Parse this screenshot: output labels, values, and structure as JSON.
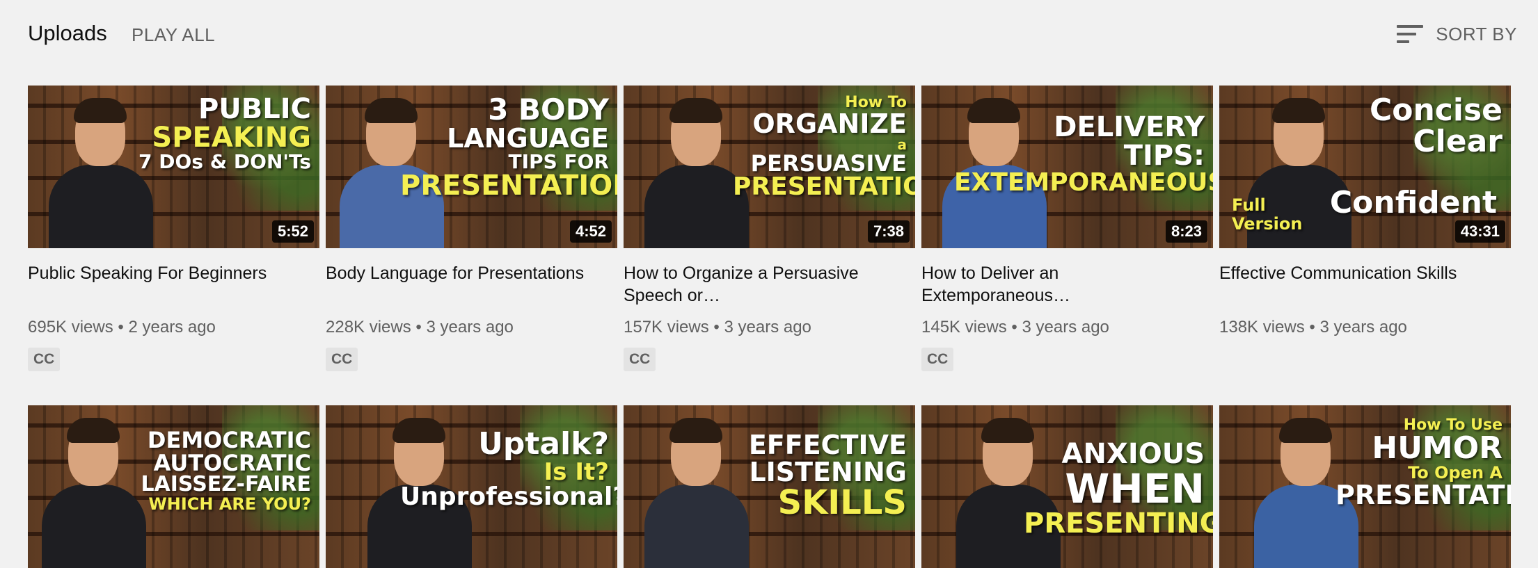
{
  "header": {
    "title": "Uploads",
    "play_all": "PLAY ALL",
    "sort_label": "SORT BY",
    "sort_icon": "sort-icon"
  },
  "colors": {
    "background": "#f1f1f1",
    "overlay_yellow": "#f4ef52",
    "overlay_white": "#ffffff",
    "meta_gray": "#606060"
  },
  "videos": [
    {
      "title": "Public Speaking For Beginners",
      "views": "695K views",
      "age": "2 years ago",
      "badge": "CC",
      "duration": "5:52",
      "overlay": [
        "PUBLIC",
        "SPEAKING",
        "7 DOs & DON'Ts"
      ]
    },
    {
      "title": "Body Language for Presentations",
      "views": "228K views",
      "age": "3 years ago",
      "badge": "CC",
      "duration": "4:52",
      "overlay": [
        "3 BODY",
        "LANGUAGE",
        "TIPS FOR",
        "PRESENTATIONS"
      ]
    },
    {
      "title": "How to Organize a Persuasive Speech or…",
      "views": "157K views",
      "age": "3 years ago",
      "badge": "CC",
      "duration": "7:38",
      "overlay": [
        "How To",
        "ORGANIZE",
        "a",
        "PERSUASIVE",
        "PRESENTATION"
      ]
    },
    {
      "title": "How to Deliver an Extemporaneous…",
      "views": "145K views",
      "age": "3 years ago",
      "badge": "CC",
      "duration": "8:23",
      "overlay": [
        "DELIVERY",
        "TIPS:",
        "EXTEMPORANEOUS"
      ]
    },
    {
      "title": "Effective Communication Skills",
      "views": "138K views",
      "age": "3 years ago",
      "badge": "",
      "duration": "43:31",
      "overlay": [
        "Concise",
        "Clear",
        "Full Version",
        "Confident"
      ]
    },
    {
      "overlay": [
        "DEMOCRATIC",
        "AUTOCRATIC",
        "LAISSEZ-FAIRE",
        "WHICH ARE YOU?"
      ]
    },
    {
      "overlay": [
        "Uptalk?",
        "Is It?",
        "Unprofessional?"
      ]
    },
    {
      "overlay": [
        "EFFECTIVE",
        "LISTENING",
        "SKILLS"
      ]
    },
    {
      "overlay": [
        "ANXIOUS",
        "WHEN",
        "PRESENTING?"
      ]
    },
    {
      "overlay": [
        "How To Use",
        "HUMOR",
        "To Open A",
        "PRESENTATION"
      ]
    }
  ]
}
